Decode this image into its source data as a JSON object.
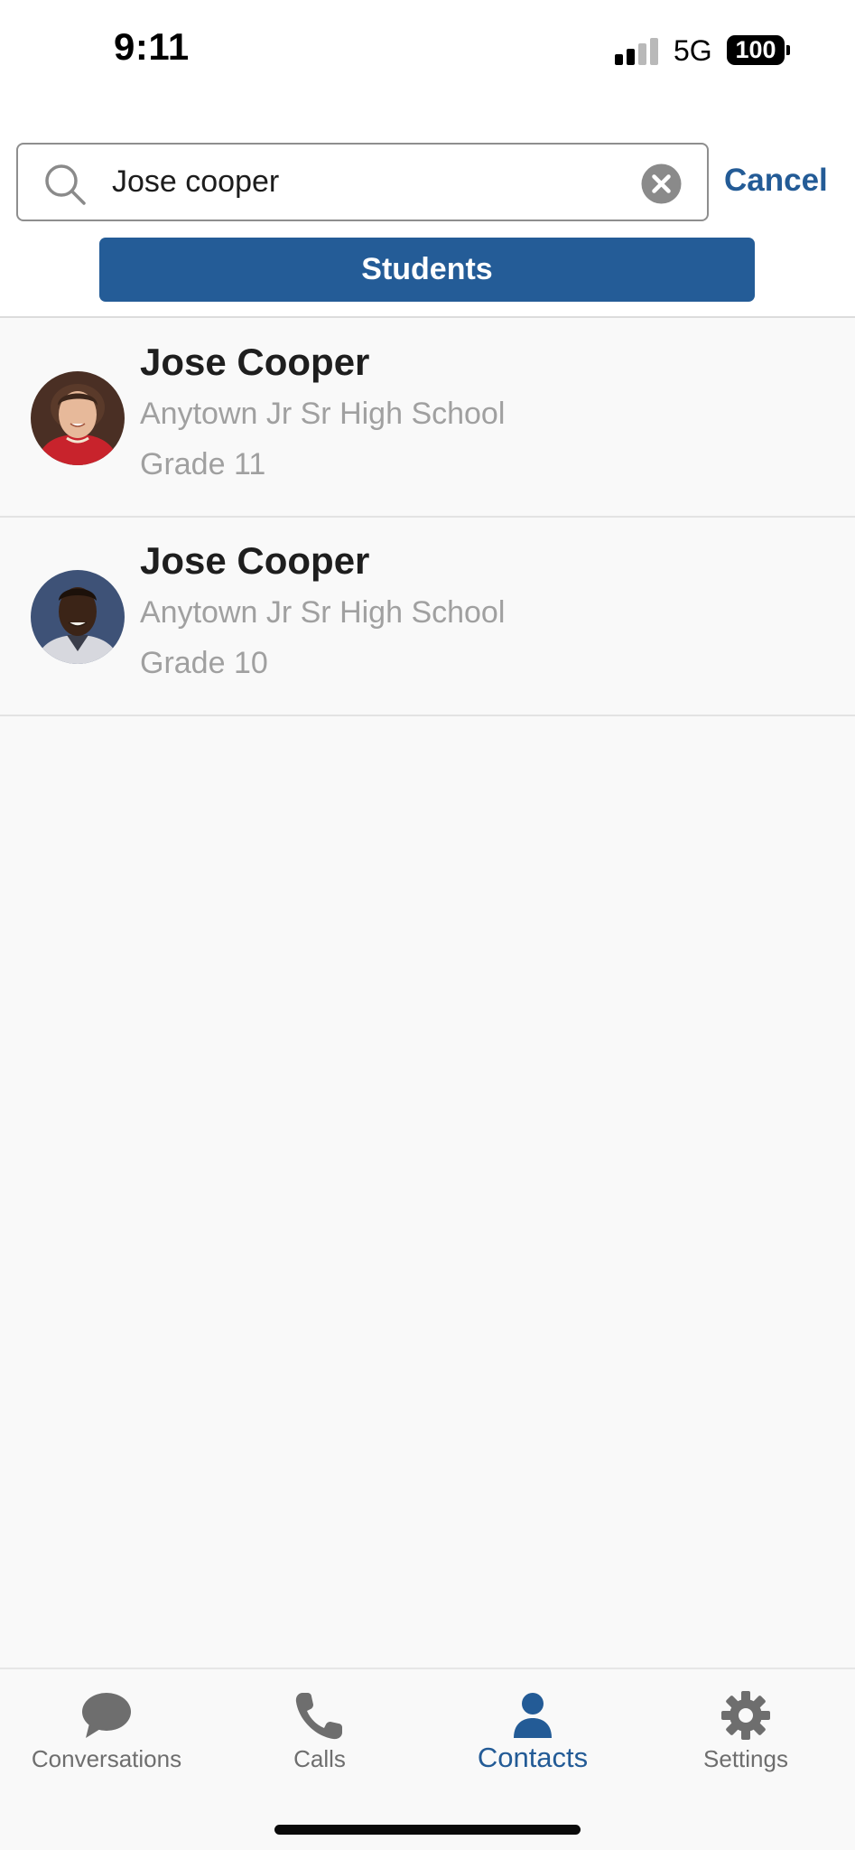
{
  "status_bar": {
    "time": "9:11",
    "network": "5G",
    "battery": "100"
  },
  "search": {
    "value": "Jose cooper",
    "cancel_label": "Cancel"
  },
  "filter": {
    "label": "Students"
  },
  "results": [
    {
      "name": "Jose Cooper",
      "school": "Anytown Jr Sr High School",
      "grade": "Grade 11"
    },
    {
      "name": "Jose Cooper",
      "school": "Anytown Jr Sr High School",
      "grade": "Grade 10"
    }
  ],
  "tabs": [
    {
      "label": "Conversations",
      "icon": "chat-bubble-icon",
      "active": false
    },
    {
      "label": "Calls",
      "icon": "phone-icon",
      "active": false
    },
    {
      "label": "Contacts",
      "icon": "person-icon",
      "active": true
    },
    {
      "label": "Settings",
      "icon": "gear-icon",
      "active": false
    }
  ],
  "colors": {
    "accent": "#245c97",
    "secondary_text": "#a0a0a0",
    "tab_inactive": "#6e6e6e"
  }
}
